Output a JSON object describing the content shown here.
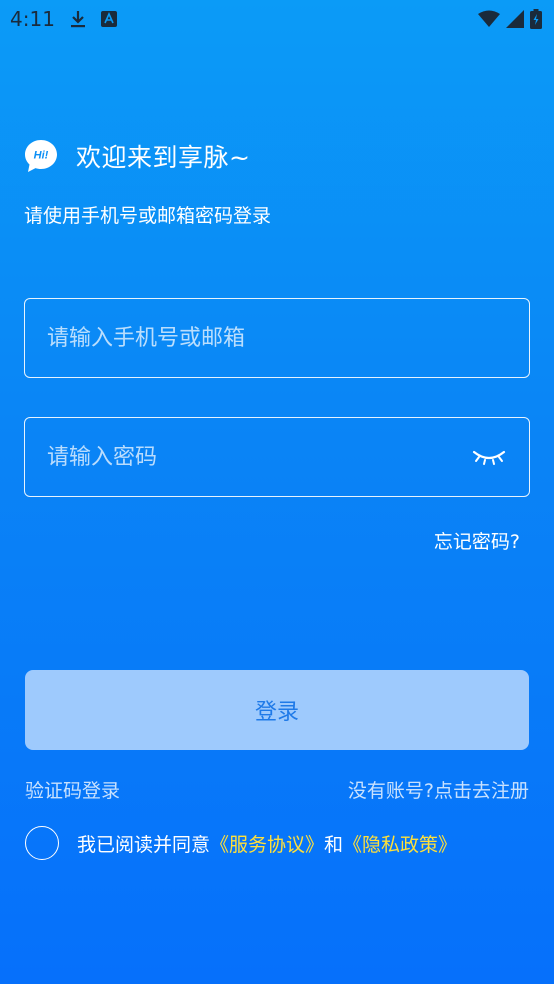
{
  "status_bar": {
    "time": "4:11"
  },
  "header": {
    "title": "欢迎来到享脉~",
    "subtitle": "请使用手机号或邮箱密码登录",
    "logo_text": "Hi!"
  },
  "form": {
    "phone_placeholder": "请输入手机号或邮箱",
    "password_placeholder": "请输入密码",
    "forgot_label": "忘记密码?",
    "login_label": "登录"
  },
  "links": {
    "sms_login": "验证码登录",
    "register": "没有账号?点击去注册"
  },
  "agreement": {
    "prefix": "我已阅读并同意",
    "service": "《服务协议》",
    "and": "和",
    "privacy": "《隐私政策》"
  },
  "colors": {
    "background_top": "#0b9bf7",
    "background_bottom": "#0670fb",
    "button_bg": "#9ecafd",
    "button_text": "#1f7ae8",
    "link_highlight": "#ffe03a"
  }
}
